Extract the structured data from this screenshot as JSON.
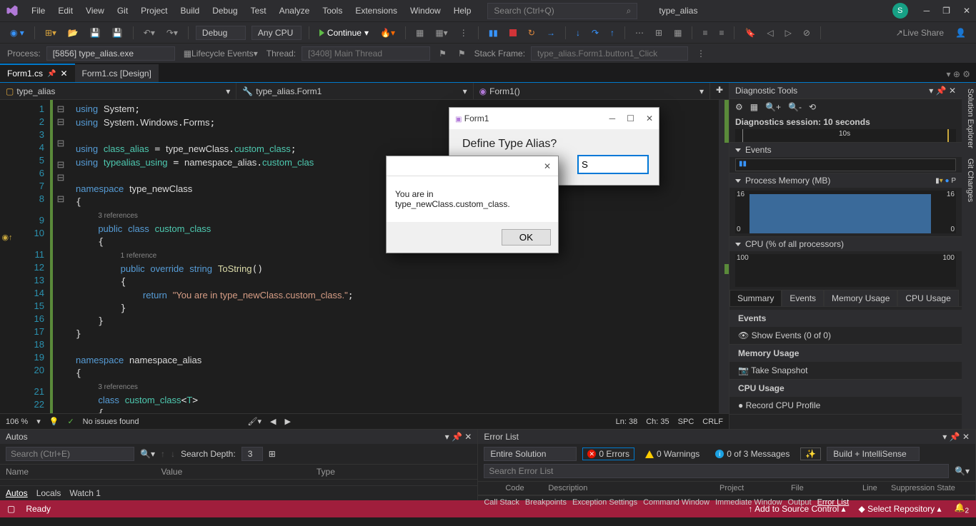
{
  "app": {
    "solution_name": "type_alias"
  },
  "menu": [
    "File",
    "Edit",
    "View",
    "Git",
    "Project",
    "Build",
    "Debug",
    "Test",
    "Analyze",
    "Tools",
    "Extensions",
    "Window",
    "Help"
  ],
  "search": {
    "placeholder": "Search (Ctrl+Q)"
  },
  "avatar": "S",
  "toolbar": {
    "config": "Debug",
    "platform": "Any CPU",
    "continue": "Continue",
    "liveshare": "Live Share"
  },
  "debugbar": {
    "process_lbl": "Process:",
    "process": "[5856] type_alias.exe",
    "lifecycle": "Lifecycle Events",
    "thread_lbl": "Thread:",
    "thread": "[3408] Main Thread",
    "stack_lbl": "Stack Frame:",
    "stack": "type_alias.Form1.button1_Click"
  },
  "tabs": [
    {
      "label": "Form1.cs",
      "active": true,
      "pinned": true
    },
    {
      "label": "Form1.cs [Design]",
      "active": false
    }
  ],
  "nav": {
    "ns": "type_alias",
    "cls": "type_alias.Form1",
    "mem": "Form1()"
  },
  "code": {
    "lines": [
      1,
      2,
      3,
      4,
      5,
      6,
      7,
      8,
      9,
      10,
      11,
      12,
      13,
      14,
      15,
      16,
      17,
      18,
      19,
      20,
      21,
      22
    ],
    "refs9": "3 references",
    "refs11": "1 reference",
    "refs21": "3 references",
    "retstr": "\"You are in type_newClass.custom_class.\""
  },
  "statusstrip": {
    "zoom": "106 %",
    "issues": "No issues found",
    "ln": "Ln: 38",
    "ch": "Ch: 35",
    "spc": "SPC",
    "eol": "CRLF"
  },
  "diag": {
    "title": "Diagnostic Tools",
    "session": "Diagnostics session: 10 seconds",
    "tick": "10s",
    "events": "Events",
    "mem_title": "Process Memory (MB)",
    "mem_left": "16",
    "mem_right": "16",
    "mem_zero": "0",
    "mem_zr": "0",
    "cpu_title": "CPU (% of all processors)",
    "cpu_l": "100",
    "cpu_r": "100",
    "tabs": [
      "Summary",
      "Events",
      "Memory Usage",
      "CPU Usage"
    ],
    "events_h": "Events",
    "show_events": "Show Events (0 of 0)",
    "mem_h": "Memory Usage",
    "snapshot": "Take Snapshot",
    "cpu_h": "CPU Usage",
    "record": "Record CPU Profile"
  },
  "sidetabs": [
    "Solution Explorer",
    "Git Changes"
  ],
  "autos": {
    "title": "Autos",
    "search": "Search (Ctrl+E)",
    "depth_lbl": "Search Depth:",
    "depth": "3",
    "cols": [
      "Name",
      "Value",
      "Type"
    ],
    "tabs": [
      "Autos",
      "Locals",
      "Watch 1"
    ]
  },
  "errlist": {
    "title": "Error List",
    "scope": "Entire Solution",
    "errs": "0 Errors",
    "warns": "0 Warnings",
    "msgs": "0 of 3 Messages",
    "build": "Build + IntelliSense",
    "search": "Search Error List",
    "cols": [
      "Code",
      "Description",
      "Project",
      "File",
      "Line",
      "Suppression State"
    ],
    "bottom_tabs": [
      "Call Stack",
      "Breakpoints",
      "Exception Settings",
      "Command Window",
      "Immediate Window",
      "Output",
      "Error List"
    ]
  },
  "statusbar": {
    "ready": "Ready",
    "src": "Add to Source Control",
    "repo": "Select Repository",
    "bell": "2"
  },
  "form": {
    "title": "Form1",
    "heading": "Define Type Alias?",
    "input": "S"
  },
  "msgbox": {
    "text": "You are in type_newClass.custom_class.",
    "ok": "OK"
  }
}
